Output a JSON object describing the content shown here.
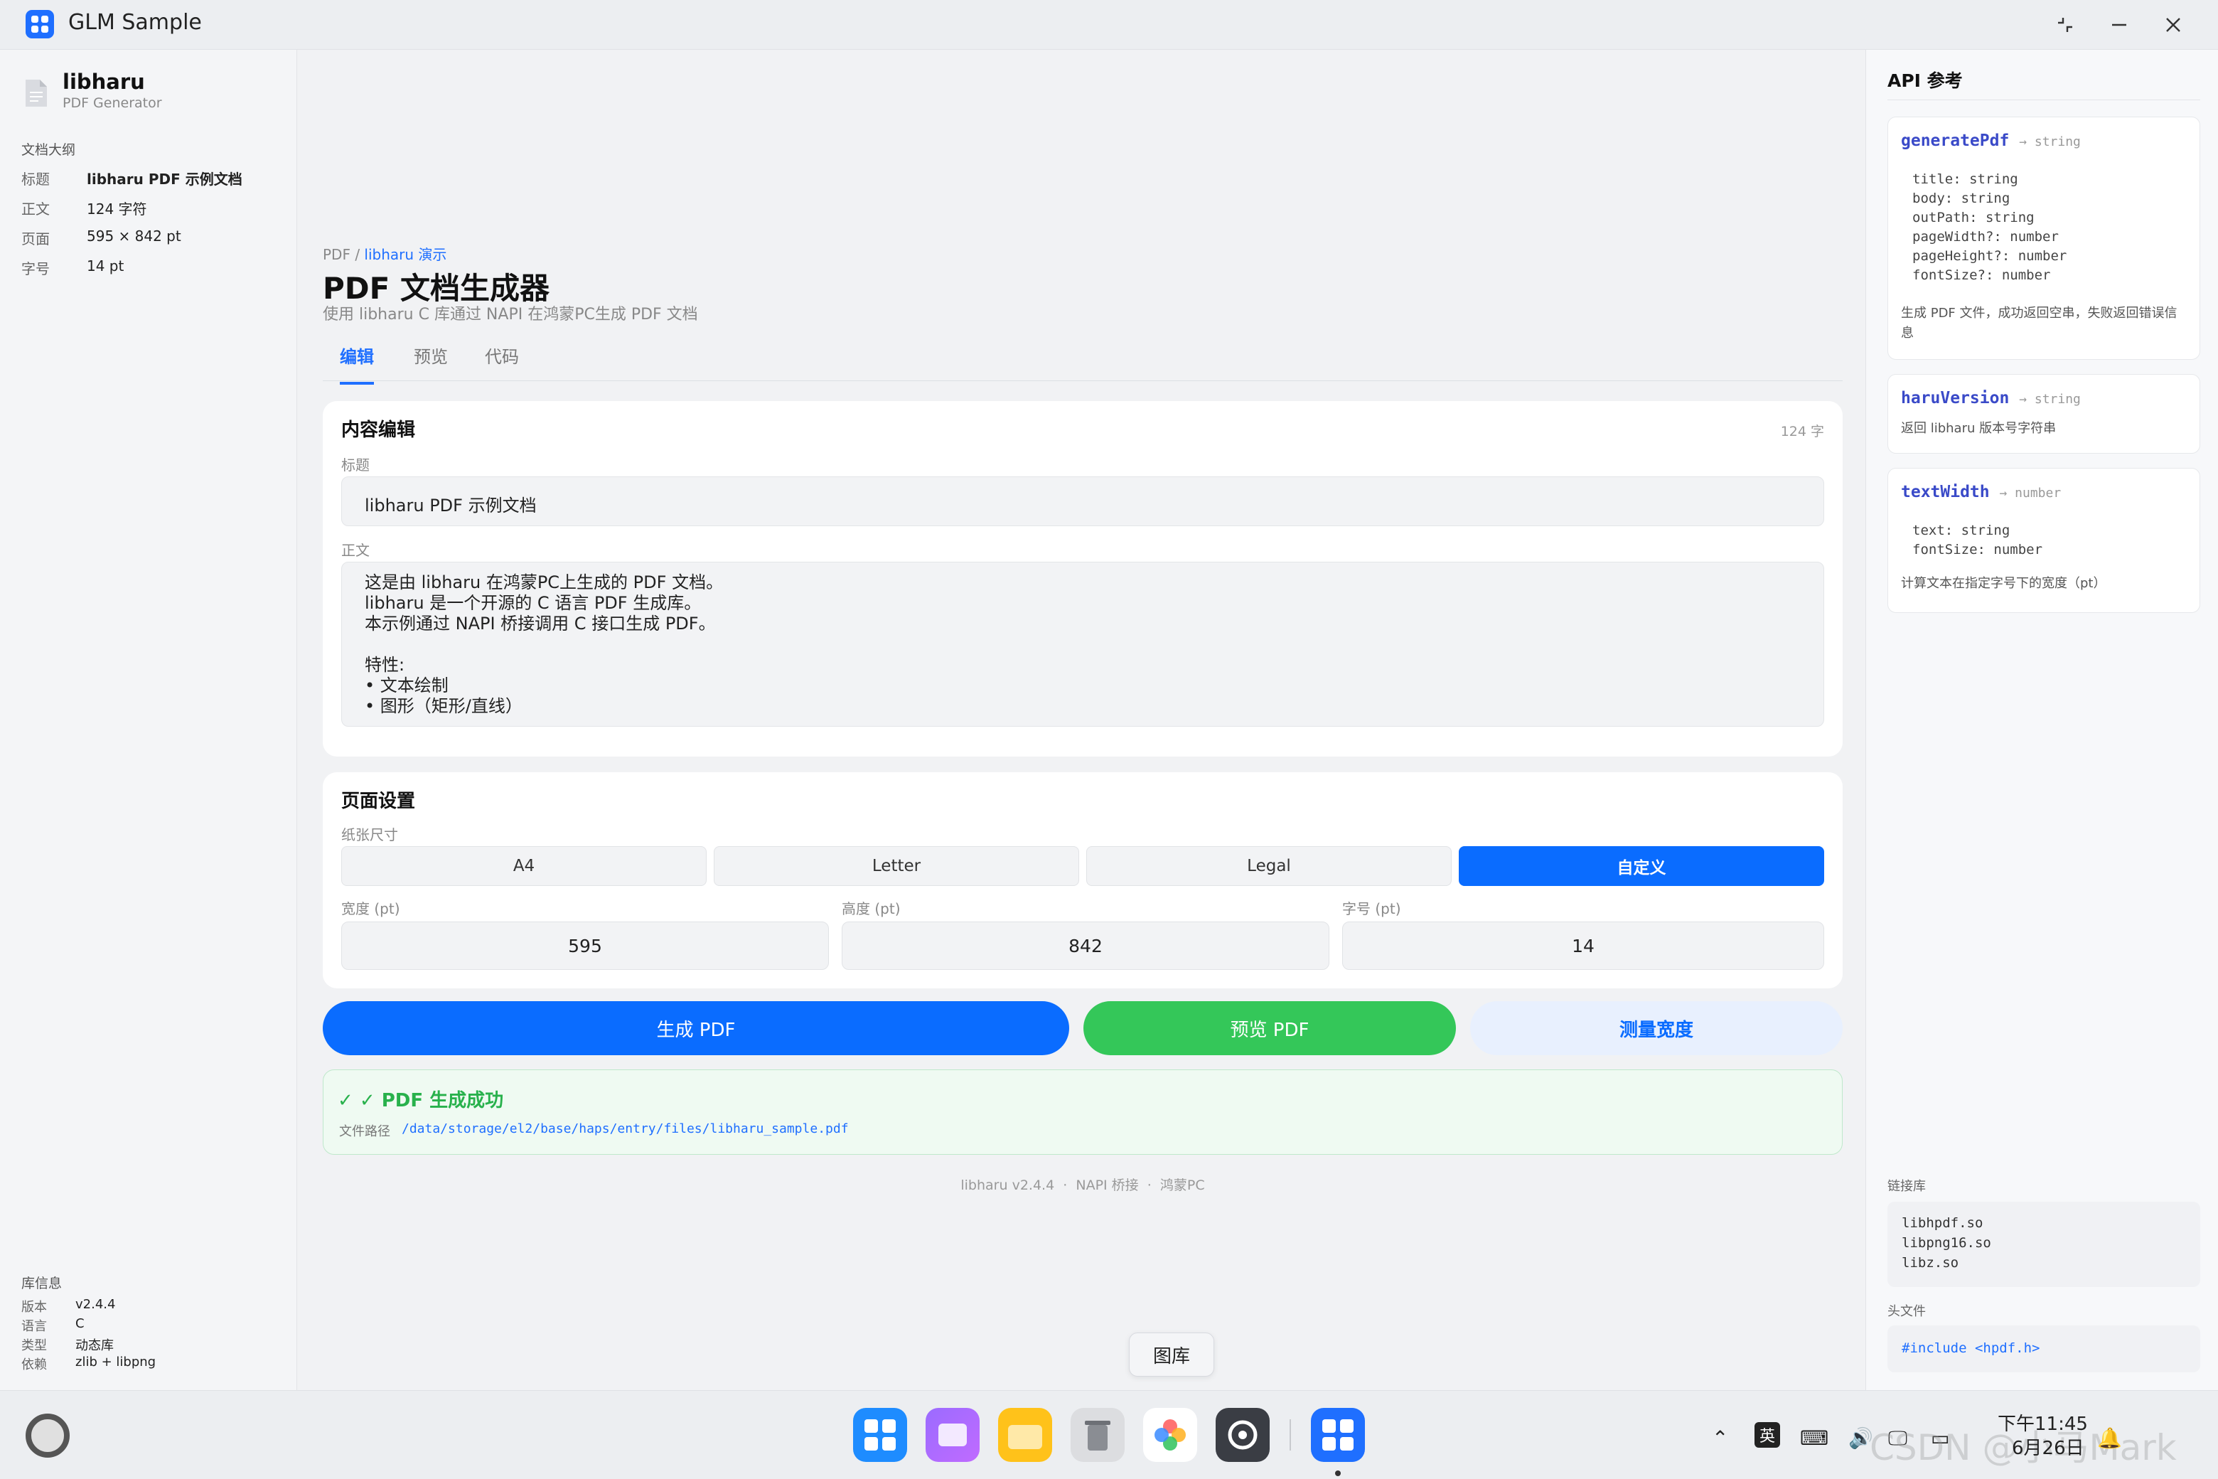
{
  "window": {
    "title": "GLM Sample"
  },
  "sidebar": {
    "lib_name": "libharu",
    "lib_sub": "PDF Generator",
    "outline_head": "文档大纲",
    "outline": [
      {
        "k": "标题",
        "v": "libharu PDF 示例文档"
      },
      {
        "k": "正文",
        "v": "124 字符"
      },
      {
        "k": "页面",
        "v": "595 × 842 pt"
      },
      {
        "k": "字号",
        "v": "14 pt"
      }
    ],
    "info_head": "库信息",
    "info": [
      {
        "k": "版本",
        "v": "v2.4.4"
      },
      {
        "k": "语言",
        "v": "C"
      },
      {
        "k": "类型",
        "v": "动态库"
      },
      {
        "k": "依赖",
        "v": "zlib + libpng"
      }
    ]
  },
  "main": {
    "breadcrumb_root": "PDF",
    "breadcrumb_sep": " / ",
    "breadcrumb_link": "libharu 演示",
    "title": "PDF 文档生成器",
    "subtitle": "使用 libharu C 库通过 NAPI 在鸿蒙PC生成 PDF 文档",
    "tabs": [
      "编辑",
      "预览",
      "代码"
    ],
    "editor": {
      "title": "内容编辑",
      "count": "124 字",
      "title_label": "标题",
      "title_value": "libharu PDF 示例文档",
      "body_label": "正文",
      "body_lines": [
        "这是由 libharu 在鸿蒙PC上生成的 PDF 文档。",
        "libharu 是一个开源的 C 语言 PDF 生成库。",
        "本示例通过 NAPI 桥接调用 C 接口生成 PDF。",
        "",
        "特性:",
        "•  文本绘制",
        "•  图形（矩形/直线）"
      ]
    },
    "page_settings": {
      "title": "页面设置",
      "paper_label": "纸张尺寸",
      "paper_options": [
        "A4",
        "Letter",
        "Legal",
        "自定义"
      ],
      "width_label": "宽度 (pt)",
      "width_value": "595",
      "height_label": "高度 (pt)",
      "height_value": "842",
      "font_label": "字号 (pt)",
      "font_value": "14"
    },
    "buttons": {
      "generate": "生成 PDF",
      "preview": "预览 PDF",
      "measure": "测量宽度"
    },
    "result": {
      "check": "✓",
      "title": "✓ PDF 生成成功",
      "path_label": "文件路径",
      "path": "/data/storage/el2/base/haps/entry/files/libharu_sample.pdf"
    },
    "footer": [
      "libharu v2.4.4",
      "NAPI 桥接",
      "鸿蒙PC"
    ]
  },
  "api": {
    "head": "API 参考",
    "items": [
      {
        "name": "generatePdf",
        "ret": "→ string",
        "params": "title: string\nbody: string\noutPath: string\npageWidth?: number\npageHeight?: number\nfontSize?: number",
        "desc": "生成 PDF 文件，成功返回空串，失败返回错误信息"
      },
      {
        "name": "haruVersion",
        "ret": "→ string",
        "params": "",
        "desc": "返回 libharu 版本号字符串"
      },
      {
        "name": "textWidth",
        "ret": "→ number",
        "params": "text: string\nfontSize: number",
        "desc": "计算文本在指定字号下的宽度（pt）"
      }
    ],
    "libs_head": "链接库",
    "libs": "libhpdf.so\nlibpng16.so\nlibz.so",
    "header_head": "头文件",
    "header": "#include <hpdf.h>"
  },
  "taskbar": {
    "tooltip": "图库",
    "ime": "英",
    "time": "下午11:45",
    "date": "6月26日",
    "watermark": "CSDN @小马Mark"
  },
  "colors": {
    "accent": "#0a6cff",
    "success": "#34c759",
    "api_name": "#3a4ac8"
  }
}
